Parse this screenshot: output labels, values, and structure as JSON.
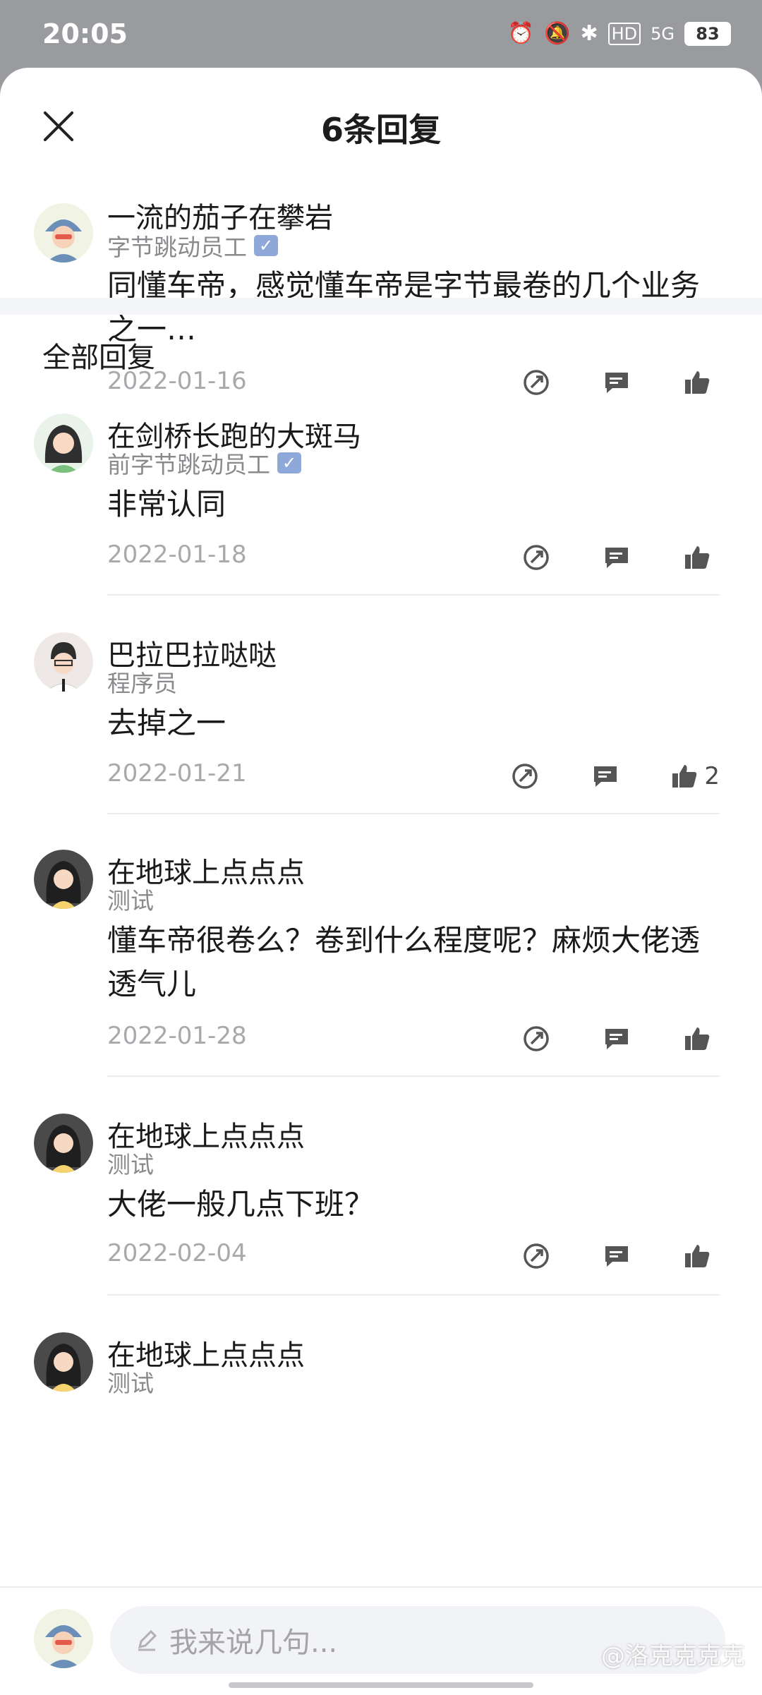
{
  "status_bar": {
    "time": "20:05",
    "battery": "83",
    "signal": "5G",
    "hd": "HD"
  },
  "header": {
    "title": "6条回复"
  },
  "main_comment": {
    "name": "一流的茄子在攀岩",
    "role": "字节跳动员工",
    "text": "同懂车帝，感觉懂车帝是字节最卷的几个业务之一…",
    "date": "2022-01-16"
  },
  "section_title": "全部回复",
  "replies": [
    {
      "name": "在剑桥长跑的大斑马",
      "role": "前字节跳动员工",
      "verified": true,
      "text": "非常认同",
      "date": "2022-01-18",
      "likes": ""
    },
    {
      "name": "巴拉巴拉哒哒",
      "role": "程序员",
      "verified": false,
      "text": "去掉之一",
      "date": "2022-01-21",
      "likes": "2"
    },
    {
      "name": "在地球上点点点",
      "role": "测试",
      "verified": false,
      "text": "懂车帝很卷么？卷到什么程度呢？麻烦大佬透透气儿",
      "date": "2022-01-28",
      "likes": ""
    },
    {
      "name": "在地球上点点点",
      "role": "测试",
      "verified": false,
      "text": "大佬一般几点下班？",
      "date": "2022-02-04",
      "likes": ""
    },
    {
      "name": "在地球上点点点",
      "role": "测试",
      "verified": false,
      "text": "",
      "date": "",
      "likes": ""
    }
  ],
  "composer": {
    "placeholder": "我来说几句..."
  },
  "watermark": "@洛克克克克",
  "icons": [
    "close-icon",
    "share-icon",
    "reply-icon",
    "like-icon",
    "pen-icon",
    "verified-icon"
  ]
}
